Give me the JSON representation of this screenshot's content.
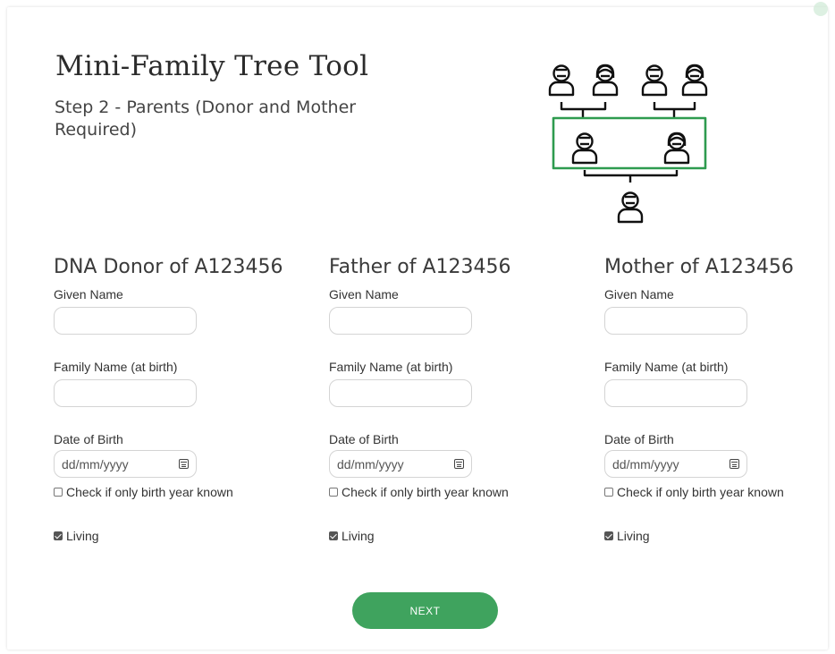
{
  "header": {
    "title": "Mini-Family Tree Tool",
    "subtitle": "Step 2 - Parents (Donor and Mother Required)"
  },
  "illustration": {
    "icon": "family-tree-icon",
    "highlight_color": "#2e9b4f"
  },
  "columns": [
    {
      "heading": "DNA Donor of A123456",
      "given_name_label": "Given Name",
      "given_name_value": "",
      "family_name_label": "Family Name (at birth)",
      "family_name_value": "",
      "dob_label": "Date of Birth",
      "dob_placeholder": "dd/mm/yyyy",
      "birth_year_label": "Check if only birth year known",
      "birth_year_checked": false,
      "living_label": "Living",
      "living_checked": true
    },
    {
      "heading": "Father of A123456",
      "given_name_label": "Given Name",
      "given_name_value": "",
      "family_name_label": "Family Name (at birth)",
      "family_name_value": "",
      "dob_label": "Date of Birth",
      "dob_placeholder": "dd/mm/yyyy",
      "birth_year_label": "Check if only birth year known",
      "birth_year_checked": false,
      "living_label": "Living",
      "living_checked": true
    },
    {
      "heading": "Mother of A123456",
      "given_name_label": "Given Name",
      "given_name_value": "",
      "family_name_label": "Family Name (at birth)",
      "family_name_value": "",
      "dob_label": "Date of Birth",
      "dob_placeholder": "dd/mm/yyyy",
      "birth_year_label": "Check if only birth year known",
      "birth_year_checked": false,
      "living_label": "Living",
      "living_checked": true
    }
  ],
  "actions": {
    "next_label": "NEXT",
    "next_color": "#3fa35e"
  }
}
